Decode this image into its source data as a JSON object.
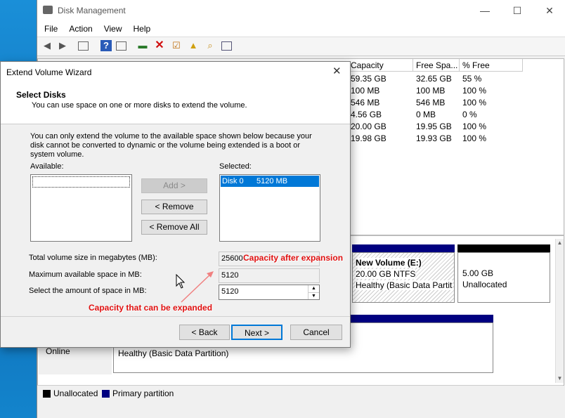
{
  "app": {
    "title": "Disk Management",
    "menu": [
      "File",
      "Action",
      "View",
      "Help"
    ],
    "window_controls": {
      "minimize": "—",
      "maximize": "☐",
      "close": "✕"
    }
  },
  "volume_table": {
    "headers": [
      "Capacity",
      "Free Spa...",
      "% Free"
    ],
    "rows": [
      [
        "59.35 GB",
        "32.65 GB",
        "55 %"
      ],
      [
        "100 MB",
        "100 MB",
        "100 %"
      ],
      [
        "546 MB",
        "546 MB",
        "100 %"
      ],
      [
        "4.56 GB",
        "0 MB",
        "0 %"
      ],
      [
        "20.00 GB",
        "19.95 GB",
        "100 %"
      ],
      [
        "19.98 GB",
        "19.93 GB",
        "100 %"
      ]
    ]
  },
  "graph": {
    "disk_new_volume": {
      "name": "New Volume  (E:)",
      "size": "20.00 GB NTFS",
      "status": "Healthy (Basic Data Partiti"
    },
    "disk_unallocated": {
      "size": "5.00 GB",
      "status": "Unallocated"
    },
    "disk2_online": "Online",
    "disk2_partition_status": "Healthy (Basic Data Partition)"
  },
  "legend": {
    "unallocated": "Unallocated",
    "primary": "Primary partition",
    "colors": {
      "unallocated": "#000000",
      "primary": "#000080"
    }
  },
  "wizard": {
    "title": "Extend Volume Wizard",
    "heading": "Select Disks",
    "subheading": "You can use space on one or more disks to extend the volume.",
    "info": "You can only extend the volume to the available space shown below because your disk cannot be converted to dynamic or the volume being extended is a boot or system volume.",
    "available_label": "Available:",
    "selected_label": "Selected:",
    "add_button": "Add >",
    "remove_button": "< Remove",
    "remove_all_button": "< Remove All",
    "selected_item_disk": "Disk 0",
    "selected_item_size": "5120 MB",
    "total_label": "Total volume size in megabytes (MB):",
    "total_value": "25600",
    "max_label": "Maximum available space in MB:",
    "max_value": "5120",
    "amount_label": "Select the amount of space in MB:",
    "amount_value": "5120",
    "back_button": "< Back",
    "next_button": "Next >",
    "cancel_button": "Cancel"
  },
  "annotations": {
    "after_expansion": "Capacity after expansion",
    "can_be_expanded": "Capacity that can be expanded",
    "color": "#e01010"
  }
}
